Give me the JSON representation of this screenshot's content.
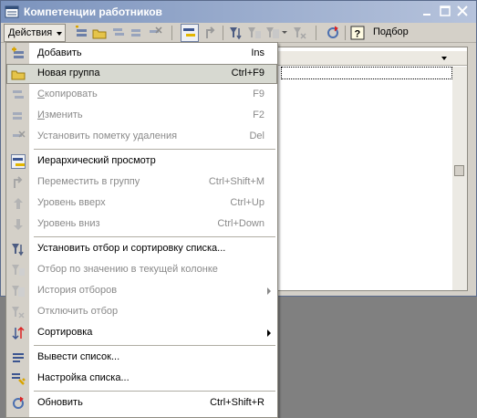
{
  "window": {
    "title": "Компетенции работников",
    "icon": "form-icon",
    "controls": [
      "minimize-icon",
      "maximize-icon",
      "close-icon"
    ]
  },
  "toolbar": {
    "actions_label": "Действия",
    "podbor_label": "Подбор",
    "icons": [
      "add-icon",
      "add-group-icon",
      "copy-icon",
      "edit-icon",
      "mark-delete-icon",
      "hierarchy-icon",
      "move-to-group-icon",
      "filter-sort-icon",
      "filter-by-value-icon",
      "filter-history-icon",
      "cancel-filter-icon",
      "refresh-icon",
      "help-icon"
    ]
  },
  "menu": {
    "items": [
      {
        "label": "Добавить",
        "accel": "Д",
        "rest": "обавить",
        "shortcut": "Ins",
        "disabled": false,
        "icon": "add-icon"
      },
      {
        "label": "Новая группа",
        "shortcut": "Ctrl+F9",
        "disabled": false,
        "highlighted": true,
        "icon": "add-group-icon"
      },
      {
        "label": "Скопировать",
        "accel": "С",
        "rest": "копировать",
        "shortcut": "F9",
        "disabled": true,
        "icon": "copy-icon"
      },
      {
        "label": "Изменить",
        "accel": "И",
        "rest": "зменить",
        "shortcut": "F2",
        "disabled": true,
        "icon": "edit-icon"
      },
      {
        "label": "Установить пометку удаления",
        "shortcut": "Del",
        "disabled": true,
        "icon": "mark-delete-icon"
      },
      {
        "label": "Иерархический просмотр",
        "shortcut": "",
        "disabled": false,
        "icon": "hierarchy-icon"
      },
      {
        "label": "Переместить в группу",
        "shortcut": "Ctrl+Shift+M",
        "disabled": true,
        "icon": "move-to-group-icon"
      },
      {
        "label": "Уровень вверх",
        "shortcut": "Ctrl+Up",
        "disabled": true,
        "icon": "level-up-icon"
      },
      {
        "label": "Уровень вниз",
        "shortcut": "Ctrl+Down",
        "disabled": true,
        "icon": "level-down-icon"
      },
      {
        "label": "Установить отбор и сортировку списка...",
        "shortcut": "",
        "disabled": false,
        "icon": "filter-sort-icon"
      },
      {
        "label": "Отбор по значению в текущей колонке",
        "shortcut": "",
        "disabled": true,
        "icon": "filter-by-value-icon"
      },
      {
        "label": "История отборов",
        "shortcut": "",
        "disabled": true,
        "submenu": true,
        "icon": "filter-history-icon"
      },
      {
        "label": "Отключить отбор",
        "shortcut": "",
        "disabled": true,
        "icon": "cancel-filter-icon"
      },
      {
        "label": "Сортировка",
        "shortcut": "",
        "disabled": false,
        "submenu": true,
        "icon": "sort-icon"
      },
      {
        "label": "Вывести список...",
        "shortcut": "",
        "disabled": false,
        "icon": "output-list-icon"
      },
      {
        "label": "Настройка списка...",
        "shortcut": "",
        "disabled": false,
        "icon": "list-settings-icon"
      },
      {
        "label": "Обновить",
        "shortcut": "Ctrl+Shift+R",
        "disabled": false,
        "icon": "refresh-icon"
      }
    ]
  },
  "colors": {
    "title_gradient_start": "#7b93bd",
    "title_gradient_end": "#b6c3dc",
    "highlight": "#d7d9d1",
    "disabled_text": "#8a8a8a"
  }
}
